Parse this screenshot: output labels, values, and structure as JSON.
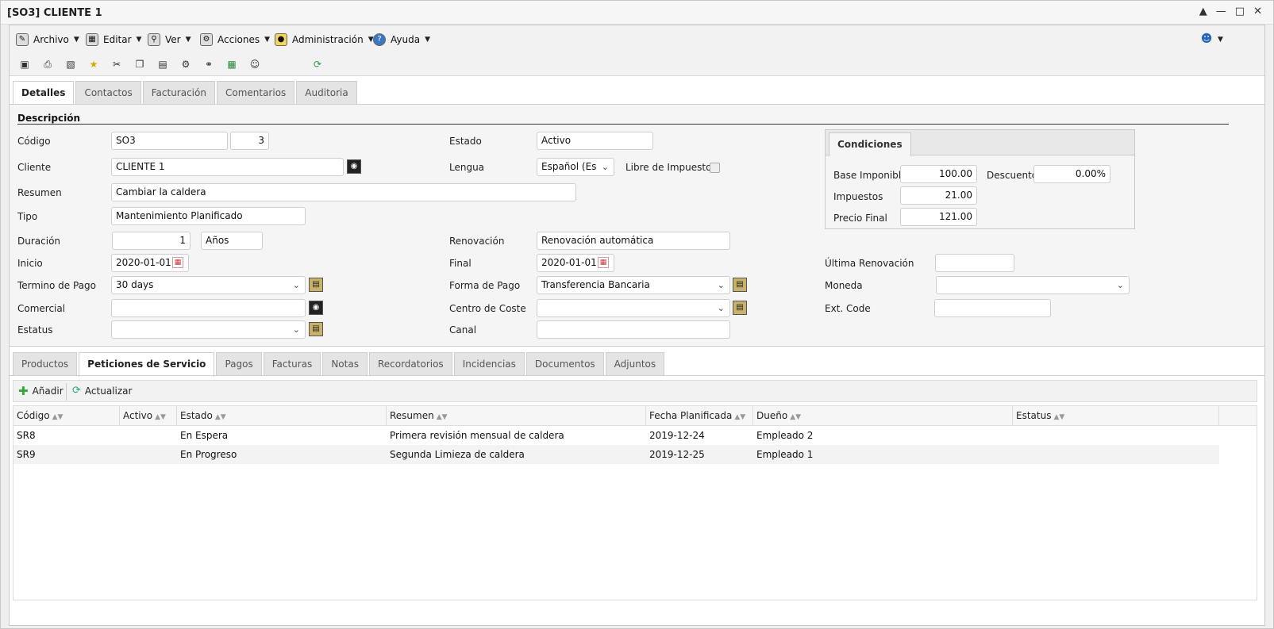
{
  "window": {
    "title": "[SO3] CLIENTE 1"
  },
  "menubar": {
    "items": [
      {
        "label": "Archivo",
        "icon": "pencil-icon"
      },
      {
        "label": "Editar",
        "icon": "edit-icon"
      },
      {
        "label": "Ver",
        "icon": "view-icon"
      },
      {
        "label": "Acciones",
        "icon": "gears-icon"
      },
      {
        "label": "Administración",
        "icon": "lock-icon"
      },
      {
        "label": "Ayuda",
        "icon": "help-icon"
      }
    ]
  },
  "top_tabs": [
    "Detalles",
    "Contactos",
    "Facturación",
    "Comentarios",
    "Auditoria"
  ],
  "form": {
    "section_title": "Descripción",
    "codigo": {
      "label": "Código",
      "value": "SO3",
      "number": "3"
    },
    "cliente": {
      "label": "Cliente",
      "value": "CLIENTE 1"
    },
    "resumen": {
      "label": "Resumen",
      "value": "Cambiar la caldera"
    },
    "tipo": {
      "label": "Tipo",
      "value": "Mantenimiento Planificado"
    },
    "duracion": {
      "label": "Duración",
      "value": "1",
      "unit": "Años"
    },
    "inicio": {
      "label": "Inicio",
      "value": "2020-01-01"
    },
    "termino": {
      "label": "Termino de Pago",
      "value": "30 days"
    },
    "comercial": {
      "label": "Comercial",
      "value": ""
    },
    "estatus": {
      "label": "Estatus",
      "value": ""
    },
    "estado": {
      "label": "Estado",
      "value": "Activo"
    },
    "lengua": {
      "label": "Lengua",
      "value": "Español (Es"
    },
    "libre": {
      "label": "Libre de Impuestos"
    },
    "renovacion": {
      "label": "Renovación",
      "value": "Renovación automática"
    },
    "final": {
      "label": "Final",
      "value": "2020-01-01"
    },
    "forma_pago": {
      "label": "Forma de Pago",
      "value": "Transferencia Bancaria"
    },
    "centro_coste": {
      "label": "Centro de Coste",
      "value": ""
    },
    "canal": {
      "label": "Canal",
      "value": ""
    },
    "ultima": {
      "label": "Última Renovación",
      "value": ""
    },
    "moneda": {
      "label": "Moneda",
      "value": ""
    },
    "ext_code": {
      "label": "Ext. Code",
      "value": ""
    }
  },
  "condiciones": {
    "tab": "Condiciones",
    "base": {
      "label": "Base Imponible",
      "value": "100.00"
    },
    "descuento": {
      "label": "Descuento",
      "value": "0.00%"
    },
    "impuestos": {
      "label": "Impuestos",
      "value": "21.00"
    },
    "precio": {
      "label": "Precio Final",
      "value": "121.00"
    }
  },
  "bottom_tabs": [
    "Productos",
    "Peticiones de Servicio",
    "Pagos",
    "Facturas",
    "Notas",
    "Recordatorios",
    "Incidencias",
    "Documentos",
    "Adjuntos"
  ],
  "grid": {
    "add_label": "Añadir",
    "refresh_label": "Actualizar",
    "columns": [
      "Código",
      "Activo",
      "Estado",
      "Resumen",
      "Fecha Planificada",
      "Dueño",
      "Estatus"
    ],
    "rows": [
      [
        "SR8",
        "",
        "En Espera",
        "Primera revisión mensual de caldera",
        "2019-12-24",
        "Empleado 2",
        ""
      ],
      [
        "SR9",
        "",
        "En Progreso",
        "Segunda Limieza de caldera",
        "2019-12-25",
        "Empleado 1",
        ""
      ]
    ]
  }
}
